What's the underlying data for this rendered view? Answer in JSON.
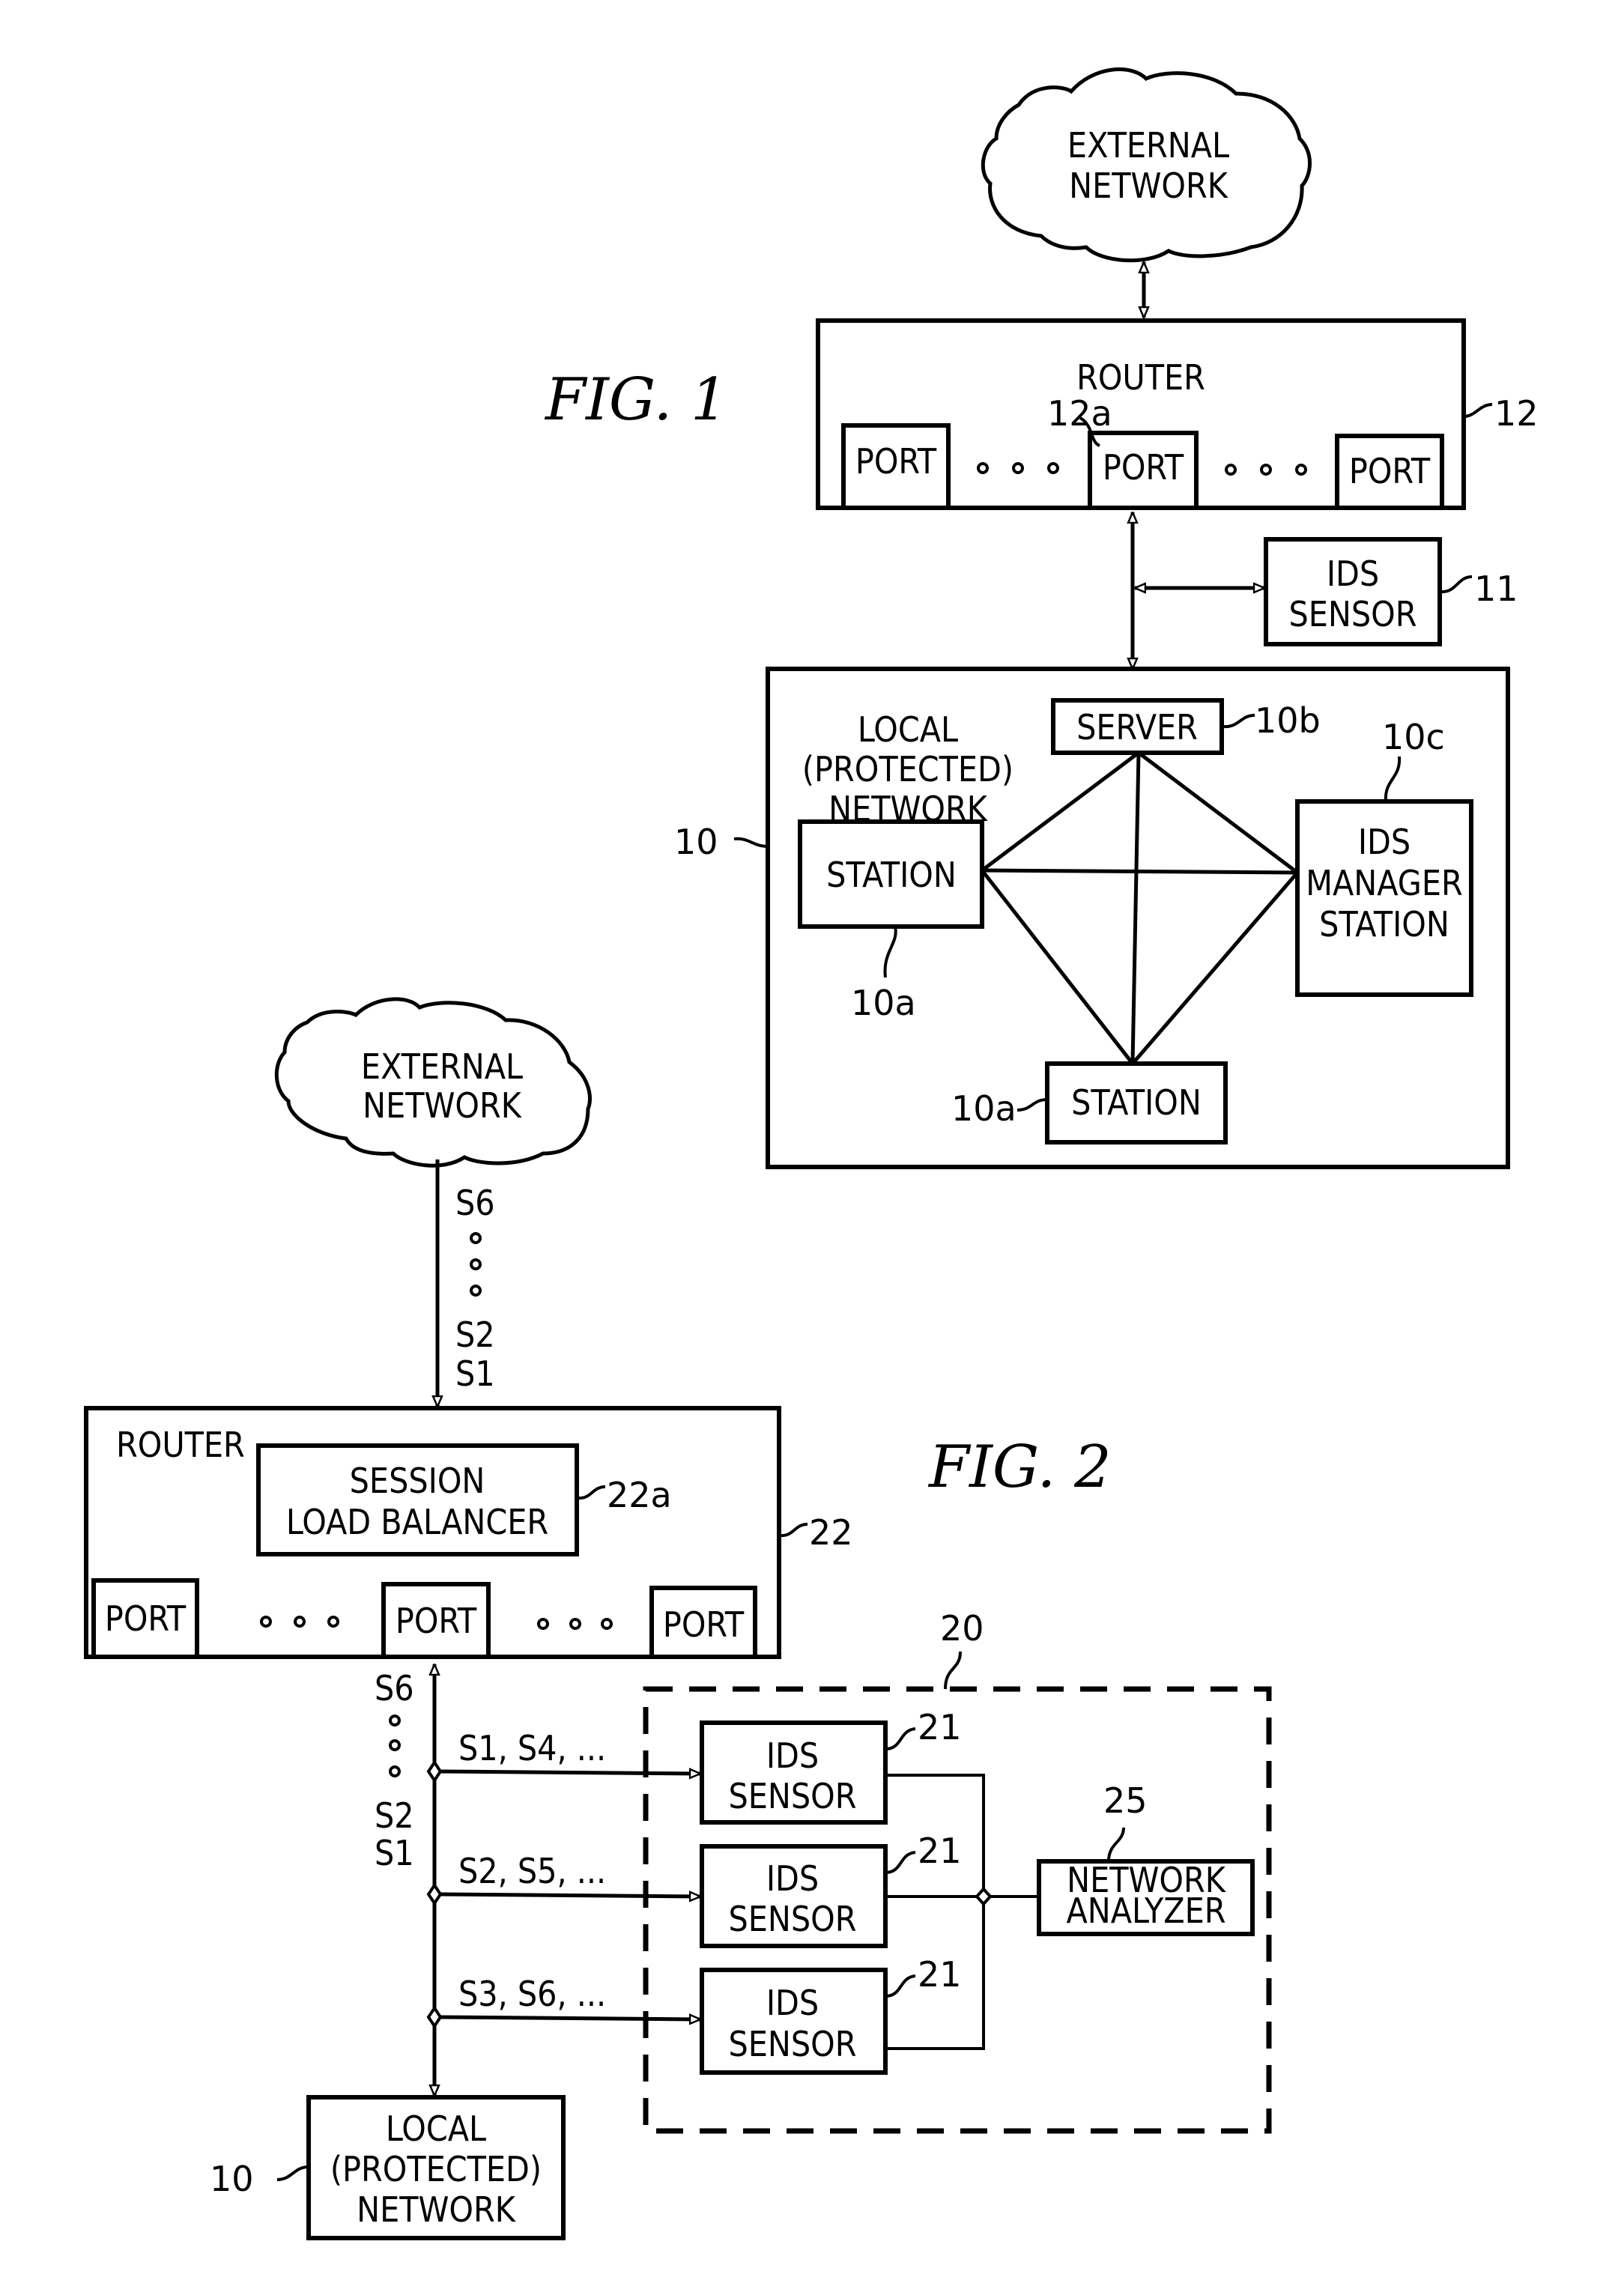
{
  "fig1": {
    "title": "FIG. 1",
    "external_network": [
      "EXTERNAL",
      "NETWORK"
    ],
    "router": {
      "label": "ROUTER",
      "ref": "12",
      "ports": [
        "PORT",
        "PORT",
        "PORT"
      ],
      "port_ref": "12a"
    },
    "ids_sensor": {
      "label": [
        "IDS",
        "SENSOR"
      ],
      "ref": "11"
    },
    "local_network": {
      "label": [
        "LOCAL",
        "(PROTECTED)",
        "NETWORK"
      ],
      "ref": "10",
      "server": {
        "label": "SERVER",
        "ref": "10b"
      },
      "station_left": {
        "label": "STATION",
        "ref": "10a"
      },
      "station_bottom": {
        "label": "STATION",
        "ref": "10a"
      },
      "ids_manager": {
        "label": [
          "IDS",
          "MANAGER",
          "STATION"
        ],
        "ref": "10c"
      }
    }
  },
  "fig2": {
    "title": "FIG. 2",
    "external_network": [
      "EXTERNAL",
      "NETWORK"
    ],
    "incoming_sessions": {
      "top": "S6",
      "bottom": [
        "S2",
        "S1"
      ]
    },
    "router": {
      "label": "ROUTER",
      "ref": "22",
      "load_balancer": {
        "label": [
          "SESSION",
          "LOAD BALANCER"
        ],
        "ref": "22a"
      },
      "ports": [
        "PORT",
        "PORT",
        "PORT"
      ]
    },
    "outgoing_sessions": {
      "top": "S6",
      "bottom": [
        "S2",
        "S1"
      ]
    },
    "ids_group_ref": "20",
    "branches": [
      {
        "sessions": "S1, S4, ...",
        "sensor": [
          "IDS",
          "SENSOR"
        ],
        "ref": "21"
      },
      {
        "sessions": "S2, S5, ...",
        "sensor": [
          "IDS",
          "SENSOR"
        ],
        "ref": "21"
      },
      {
        "sessions": "S3, S6, ...",
        "sensor": [
          "IDS",
          "SENSOR"
        ],
        "ref": "21"
      }
    ],
    "network_analyzer": {
      "label": [
        "NETWORK",
        "ANALYZER"
      ],
      "ref": "25"
    },
    "local_network": {
      "label": [
        "LOCAL",
        "(PROTECTED)",
        "NETWORK"
      ],
      "ref": "10"
    }
  }
}
